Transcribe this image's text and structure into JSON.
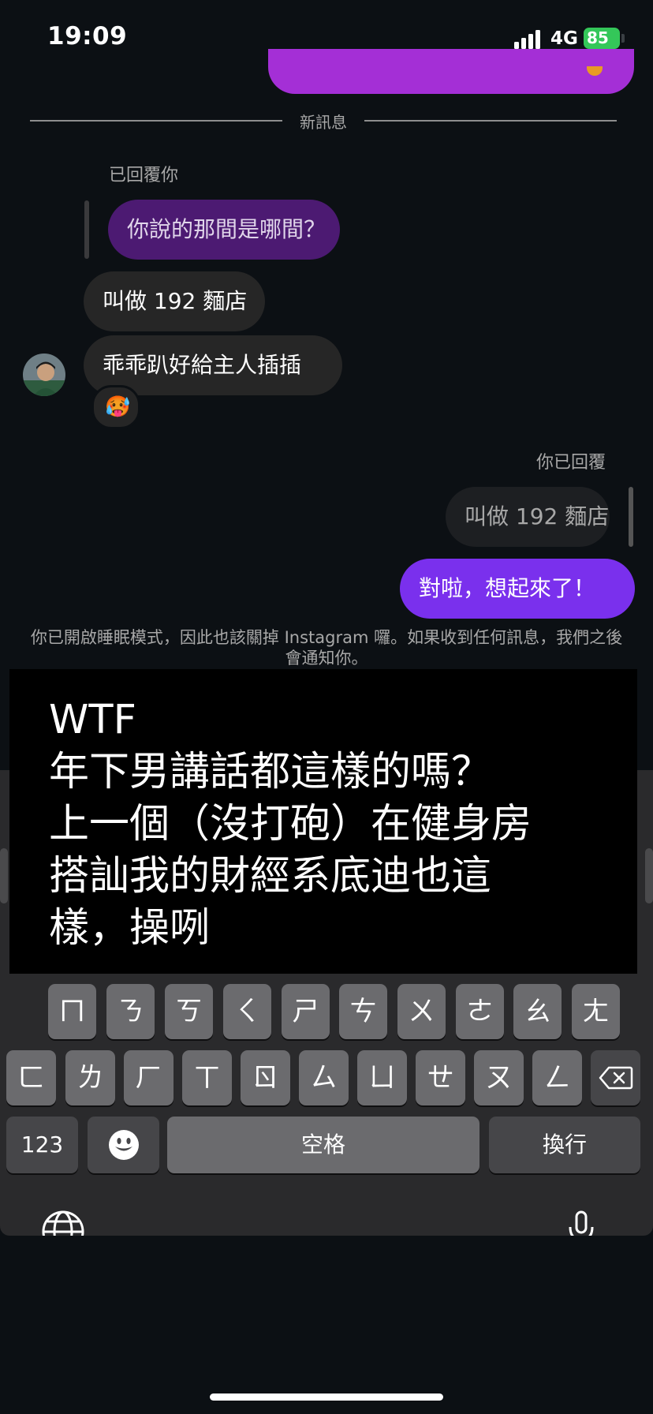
{
  "status_bar": {
    "time": "19:09",
    "network": "4G",
    "battery": "85",
    "battery_color": "#34c759"
  },
  "thread": {
    "new_messages_divider": "新訊息",
    "replied_to_you_label": "已回覆你",
    "quoted_message": "你說的那間是哪間？",
    "incoming": [
      "叫做 192 麵店",
      "乖乖趴好給主人插插"
    ],
    "reaction_emoji": "🥵",
    "you_replied_label": "你已回覆",
    "quoted_reply": "叫做 192 麵店",
    "outgoing": "對啦，想起來了！",
    "sleep_mode_notice": "你已開啟睡眠模式，因此也該關掉 Instagram 囉。如果收到任何訊息，我們之後會通知你。"
  },
  "overlay_caption": {
    "lines": [
      "WTF",
      "年下男講話都這樣的嗎？",
      "上一個（沒打砲）在健身房",
      "搭訕我的財經系底迪也這",
      "樣，操咧"
    ]
  },
  "keyboard": {
    "row1": [
      "ㄇ",
      "ㄋ",
      "ㄎ",
      "ㄑ",
      "ㄕ",
      "ㄘ",
      "ㄨ",
      "ㄜ",
      "ㄠ",
      "ㄤ"
    ],
    "row2": [
      "ㄈ",
      "ㄌ",
      "ㄏ",
      "ㄒ",
      "ㄖ",
      "ㄙ",
      "ㄩ",
      "ㄝ",
      "ㄡ",
      "ㄥ"
    ],
    "numbers_key": "123",
    "space_key": "空格",
    "return_key": "換行",
    "icons": [
      "backspace-icon",
      "emoji-icon",
      "globe-icon",
      "microphone-icon"
    ]
  },
  "colors": {
    "accent_purple": "#7a30ed",
    "prev_bubble": "#a42fd6",
    "background": "#0c1014"
  }
}
